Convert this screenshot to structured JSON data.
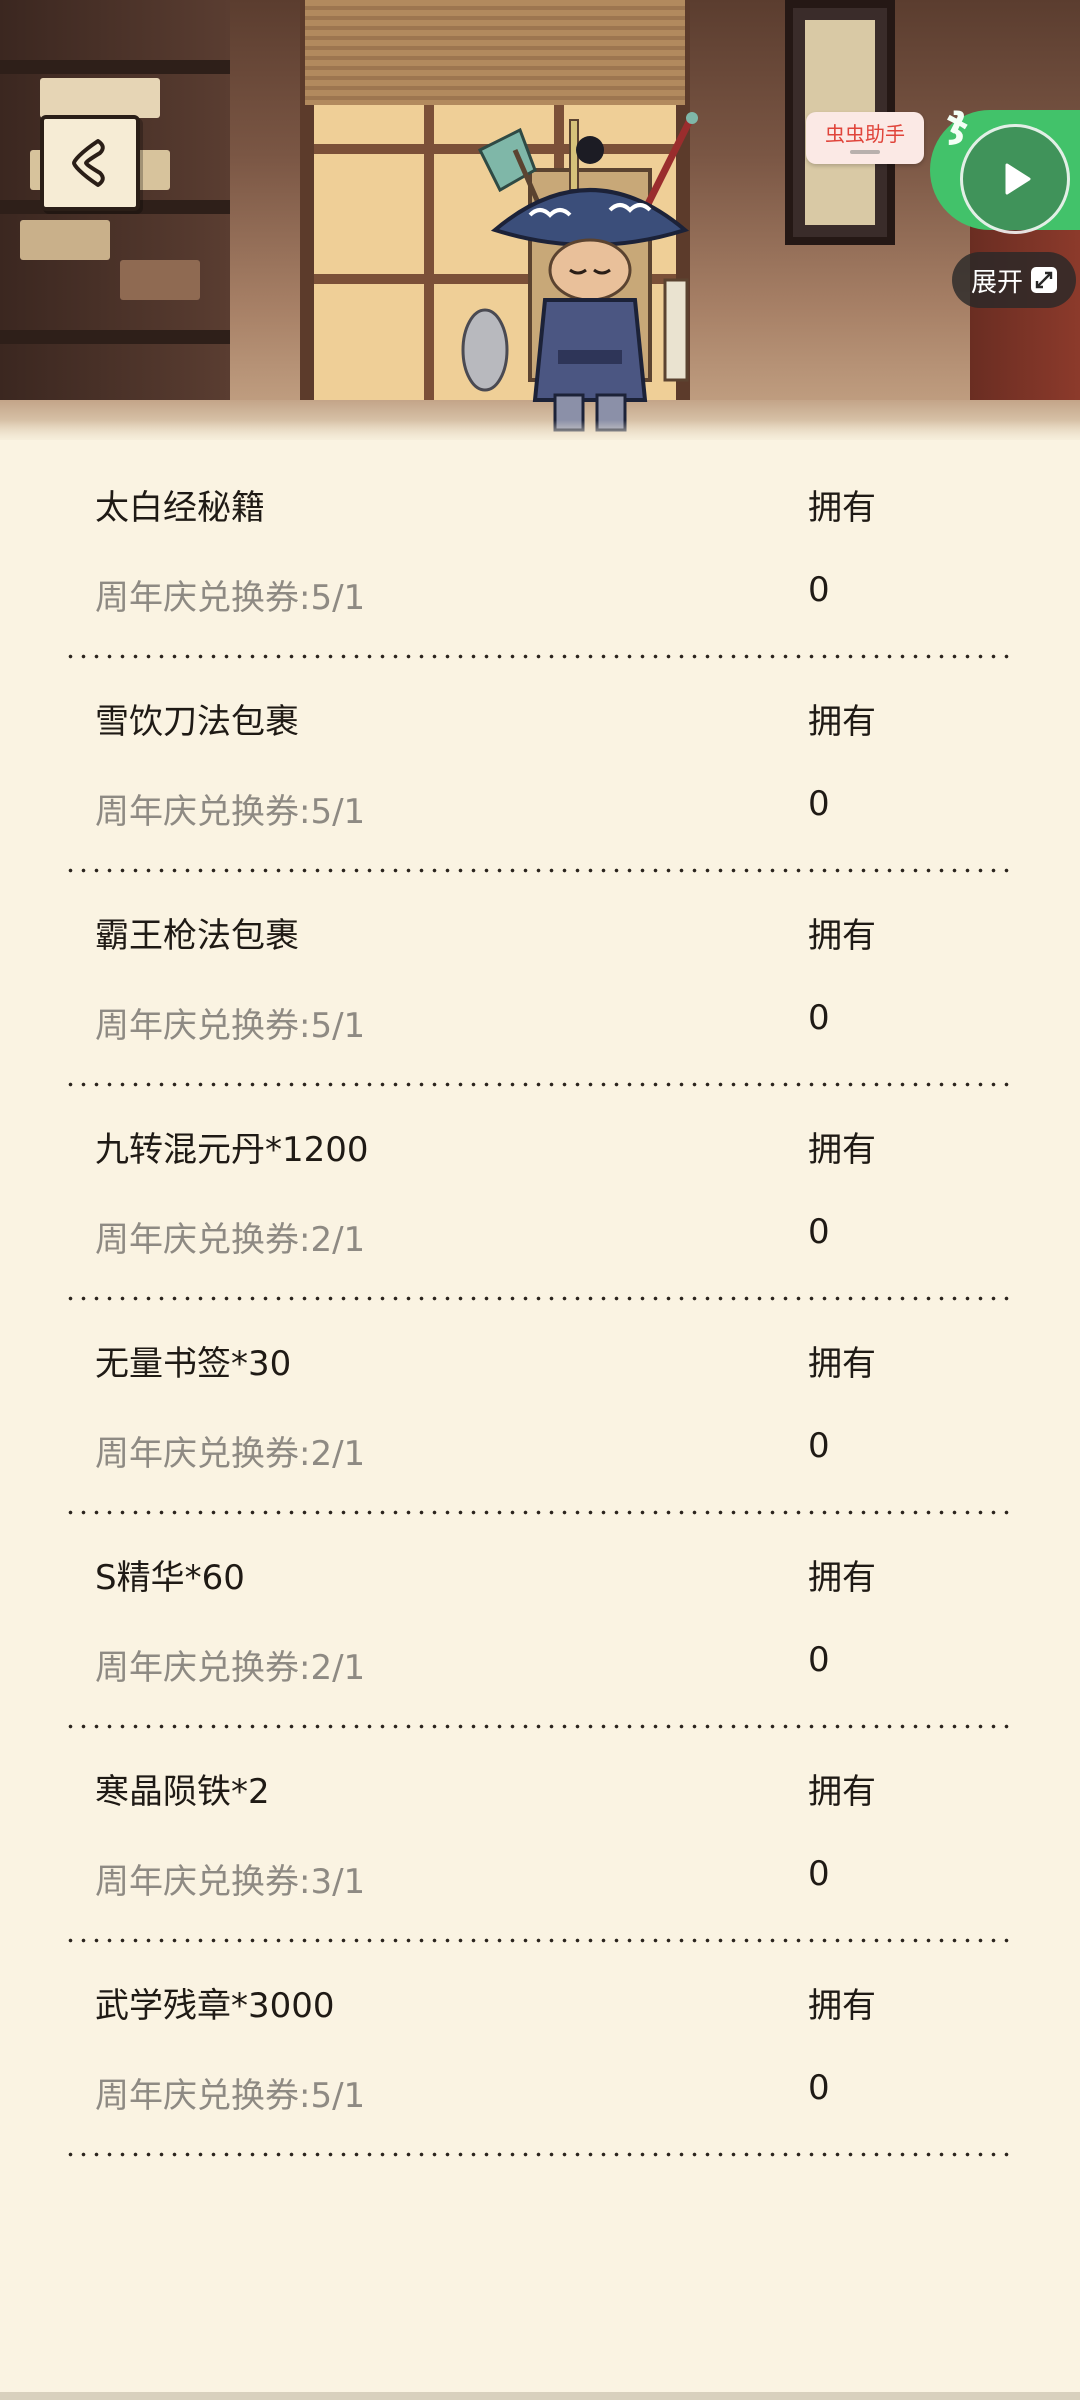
{
  "helper": {
    "label": "虫虫助手"
  },
  "expand": {
    "label": "展开"
  },
  "icons": {
    "back": "chevron-left-icon",
    "play": "play-icon",
    "expand": "expand-icon"
  },
  "colors": {
    "background": "#faf3e2",
    "text": "#1f1a15",
    "muted_text": "#8e8a83",
    "helper_red": "#e0443a",
    "badge_green": "#42c26a"
  },
  "items": [
    {
      "name": "太白经秘籍",
      "owned_label": "拥有",
      "cost": "周年庆兑换券:5/1",
      "owned": "0"
    },
    {
      "name": "雪饮刀法包裹",
      "owned_label": "拥有",
      "cost": "周年庆兑换券:5/1",
      "owned": "0"
    },
    {
      "name": "霸王枪法包裹",
      "owned_label": "拥有",
      "cost": "周年庆兑换券:5/1",
      "owned": "0"
    },
    {
      "name": "九转混元丹*1200",
      "owned_label": "拥有",
      "cost": "周年庆兑换券:2/1",
      "owned": "0"
    },
    {
      "name": "无量书签*30",
      "owned_label": "拥有",
      "cost": "周年庆兑换券:2/1",
      "owned": "0"
    },
    {
      "name": "S精华*60",
      "owned_label": "拥有",
      "cost": "周年庆兑换券:2/1",
      "owned": "0"
    },
    {
      "name": "寒晶陨铁*2",
      "owned_label": "拥有",
      "cost": "周年庆兑换券:3/1",
      "owned": "0"
    },
    {
      "name": "武学残章*3000",
      "owned_label": "拥有",
      "cost": "周年庆兑换券:5/1",
      "owned": "0"
    }
  ]
}
